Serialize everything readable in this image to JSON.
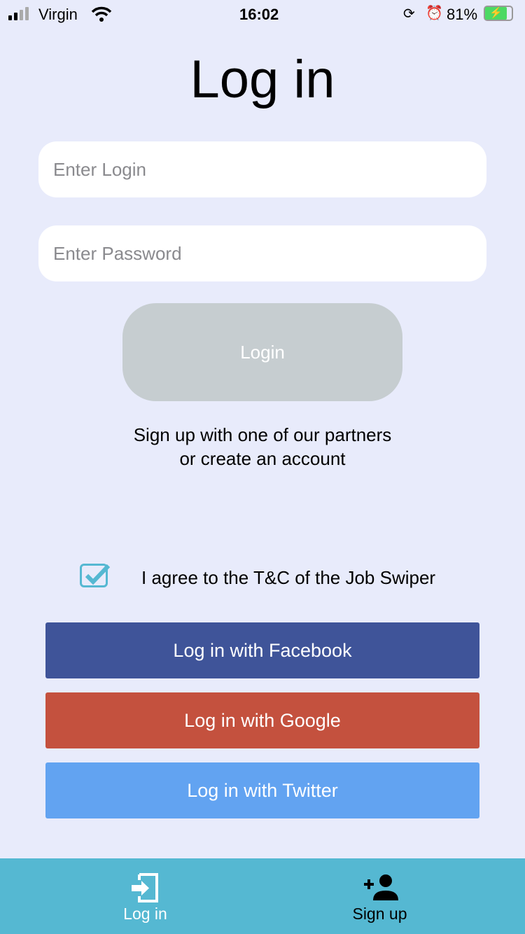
{
  "status": {
    "carrier": "Virgin",
    "time": "16:02",
    "battery": "81%",
    "battery_level": 81
  },
  "title": "Log in",
  "login_field": {
    "placeholder": "Enter Login",
    "value": ""
  },
  "password_field": {
    "placeholder": "Enter Password",
    "value": ""
  },
  "login_button": "Login",
  "info_line1": "Sign up with one of our partners",
  "info_line2": "or create an account",
  "terms": {
    "label": "I agree to the T&C of the Job Swiper",
    "checked": true
  },
  "social": [
    {
      "label": "Log in with Facebook",
      "color": "#3f5499"
    },
    {
      "label": "Log in with Google",
      "color": "#c4513e"
    },
    {
      "label": "Log in with Twitter",
      "color": "#62a3f1"
    }
  ],
  "tabs": [
    {
      "label": "Log in",
      "active": true
    },
    {
      "label": "Sign up",
      "active": false
    }
  ],
  "colors": {
    "background": "#e8ebfb",
    "tabbar": "#55b8d2",
    "checkbox": "#55b8d2"
  }
}
